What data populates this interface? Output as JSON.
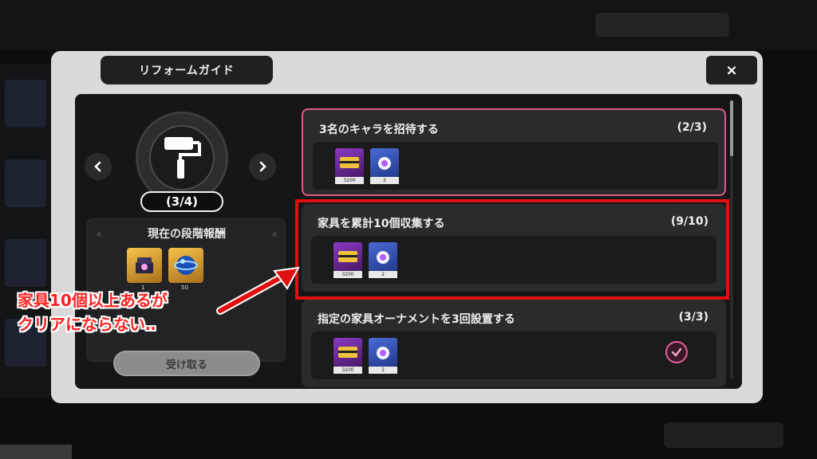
{
  "dialog": {
    "title": "リフォームガイド",
    "close_label": "×"
  },
  "stage": {
    "progress": "(3/4)",
    "reward_title": "現在の段階報酬",
    "reward_items": [
      {
        "icon": "jewel-box-icon",
        "count": "1"
      },
      {
        "icon": "blue-orb-icon",
        "count": "50"
      }
    ],
    "receive_button": "受け取る",
    "prev_icon": "chevron-left-icon",
    "next_icon": "chevron-right-icon",
    "emblem_icon": "paint-roller-icon"
  },
  "missions": [
    {
      "title": "3名のキャラを招待する",
      "progress": "(2/3)",
      "items": [
        {
          "label": "3200",
          "icon": "ticket-icon"
        },
        {
          "label": "2",
          "icon": "orb-icon"
        }
      ],
      "completed": false
    },
    {
      "title": "家具を累計10個収集する",
      "progress": "(9/10)",
      "items": [
        {
          "label": "3200",
          "icon": "ticket-icon"
        },
        {
          "label": "2",
          "icon": "orb-icon"
        }
      ],
      "completed": false
    },
    {
      "title": "指定の家具オーナメントを3回設置する",
      "progress": "(3/3)",
      "items": [
        {
          "label": "3200",
          "icon": "ticket-icon"
        },
        {
          "label": "2",
          "icon": "orb-icon"
        }
      ],
      "completed": true
    }
  ],
  "annotation": {
    "line1": "家具10個以上あるが",
    "line2": "クリアにならない‥",
    "color": "#ff2222"
  },
  "colors": {
    "highlight": "#e01010",
    "pink_border": "#e05a8d",
    "gold_reward": "#f6c34a"
  }
}
